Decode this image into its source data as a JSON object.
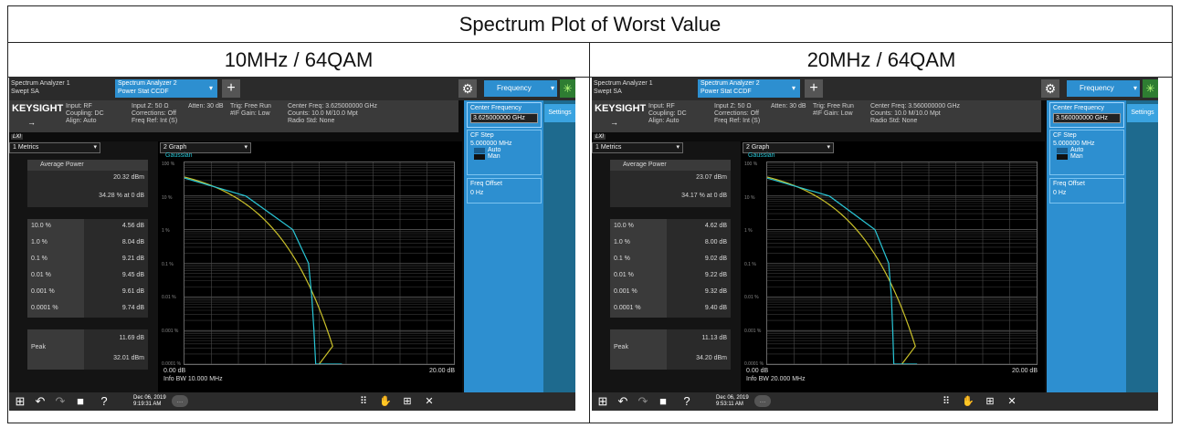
{
  "title": "Spectrum Plot of Worst Value",
  "panels": [
    {
      "heading": "10MHz / 64QAM",
      "tab1_line1": "Spectrum Analyzer 1",
      "tab1_line2": "Swept SA",
      "tab2_line1": "Spectrum Analyzer 2",
      "tab2_line2": "Power Stat CCDF",
      "brand": "KEYSIGHT",
      "info_a": "Input: RF\nCoupling: DC\nAlign: Auto",
      "info_b": "Input Z: 50 Ω\nCorrections: Off\nFreq Ref: Int (S)",
      "info_c": "Atten: 30 dB",
      "info_d": "Trig: Free Run\n#IF Gain: Low",
      "info_e": "Center Freq: 3.625000000 GHz\nCounts: 10.0 M/10.0 Mpt\nRadio Std: None",
      "freq_menu": "Frequency",
      "settings_tab": "Settings",
      "lxi": "LXI",
      "metrics_select": "1 Metrics",
      "graph_select": "2 Graph",
      "avg_power_label": "Average Power",
      "avg_power_dbm": "20.32 dBm",
      "avg_power_pct": "34.28 % at 0 dB",
      "rows": [
        {
          "l": "10.0 %",
          "v": "4.56 dB"
        },
        {
          "l": "1.0 %",
          "v": "8.04 dB"
        },
        {
          "l": "0.1 %",
          "v": "9.21 dB"
        },
        {
          "l": "0.01 %",
          "v": "9.45 dB"
        },
        {
          "l": "0.001 %",
          "v": "9.61 dB"
        },
        {
          "l": "0.0001 %",
          "v": "9.74 dB"
        }
      ],
      "peak_label": "Peak",
      "peak_db": "11.69 dB",
      "peak_dbm": "32.01 dBm",
      "gaussian": "Gaussian",
      "x_left": "0.00 dB",
      "x_right": "20.00 dB",
      "info_bw": "Info BW 10.000 MHz",
      "cf_label": "Center Frequency",
      "cf_value": "3.625000000 GHz",
      "cf_step_label": "CF Step",
      "cf_step_value": "5.000000 MHz",
      "auto": "Auto",
      "man": "Man",
      "freq_offset_label": "Freq Offset",
      "freq_offset_value": "0 Hz",
      "date": "Dec 06, 2019",
      "time": "9:19:31 AM"
    },
    {
      "heading": "20MHz / 64QAM",
      "tab1_line1": "Spectrum Analyzer 1",
      "tab1_line2": "Swept SA",
      "tab2_line1": "Spectrum Analyzer 2",
      "tab2_line2": "Power Stat CCDF",
      "brand": "KEYSIGHT",
      "info_a": "Input: RF\nCoupling: DC\nAlign: Auto",
      "info_b": "Input Z: 50 Ω\nCorrections: Off\nFreq Ref: Int (S)",
      "info_c": "Atten: 30 dB",
      "info_d": "Trig: Free Run\n#IF Gain: Low",
      "info_e": "Center Freq: 3.560000000 GHz\nCounts: 10.0 M/10.0 Mpt\nRadio Std: None",
      "freq_menu": "Frequency",
      "settings_tab": "Settings",
      "lxi": "LXI",
      "metrics_select": "1 Metrics",
      "graph_select": "2 Graph",
      "avg_power_label": "Average Power",
      "avg_power_dbm": "23.07 dBm",
      "avg_power_pct": "34.17 % at 0 dB",
      "rows": [
        {
          "l": "10.0 %",
          "v": "4.62 dB"
        },
        {
          "l": "1.0 %",
          "v": "8.00 dB"
        },
        {
          "l": "0.1 %",
          "v": "9.02 dB"
        },
        {
          "l": "0.01 %",
          "v": "9.22 dB"
        },
        {
          "l": "0.001 %",
          "v": "9.32 dB"
        },
        {
          "l": "0.0001 %",
          "v": "9.40 dB"
        }
      ],
      "peak_label": "Peak",
      "peak_db": "11.13 dB",
      "peak_dbm": "34.20 dBm",
      "gaussian": "Gaussian",
      "x_left": "0.00 dB",
      "x_right": "20.00 dB",
      "info_bw": "Info BW 20.000 MHz",
      "cf_label": "Center Frequency",
      "cf_value": "3.560000000 GHz",
      "cf_step_label": "CF Step",
      "cf_step_value": "5.000000 MHz",
      "auto": "Auto",
      "man": "Man",
      "freq_offset_label": "Freq Offset",
      "freq_offset_value": "0 Hz",
      "date": "Dec 06, 2019",
      "time": "9:53:11 AM"
    }
  ],
  "y_ticks": [
    "100 %",
    "10 %",
    "1 %",
    "0.1 %",
    "0.01 %",
    "0.001 %",
    "0.0001 %"
  ],
  "colors": {
    "accent": "#2d8fd0",
    "gaussian_curve": "#c9c02a",
    "measured_curve": "#29c6d6"
  }
}
